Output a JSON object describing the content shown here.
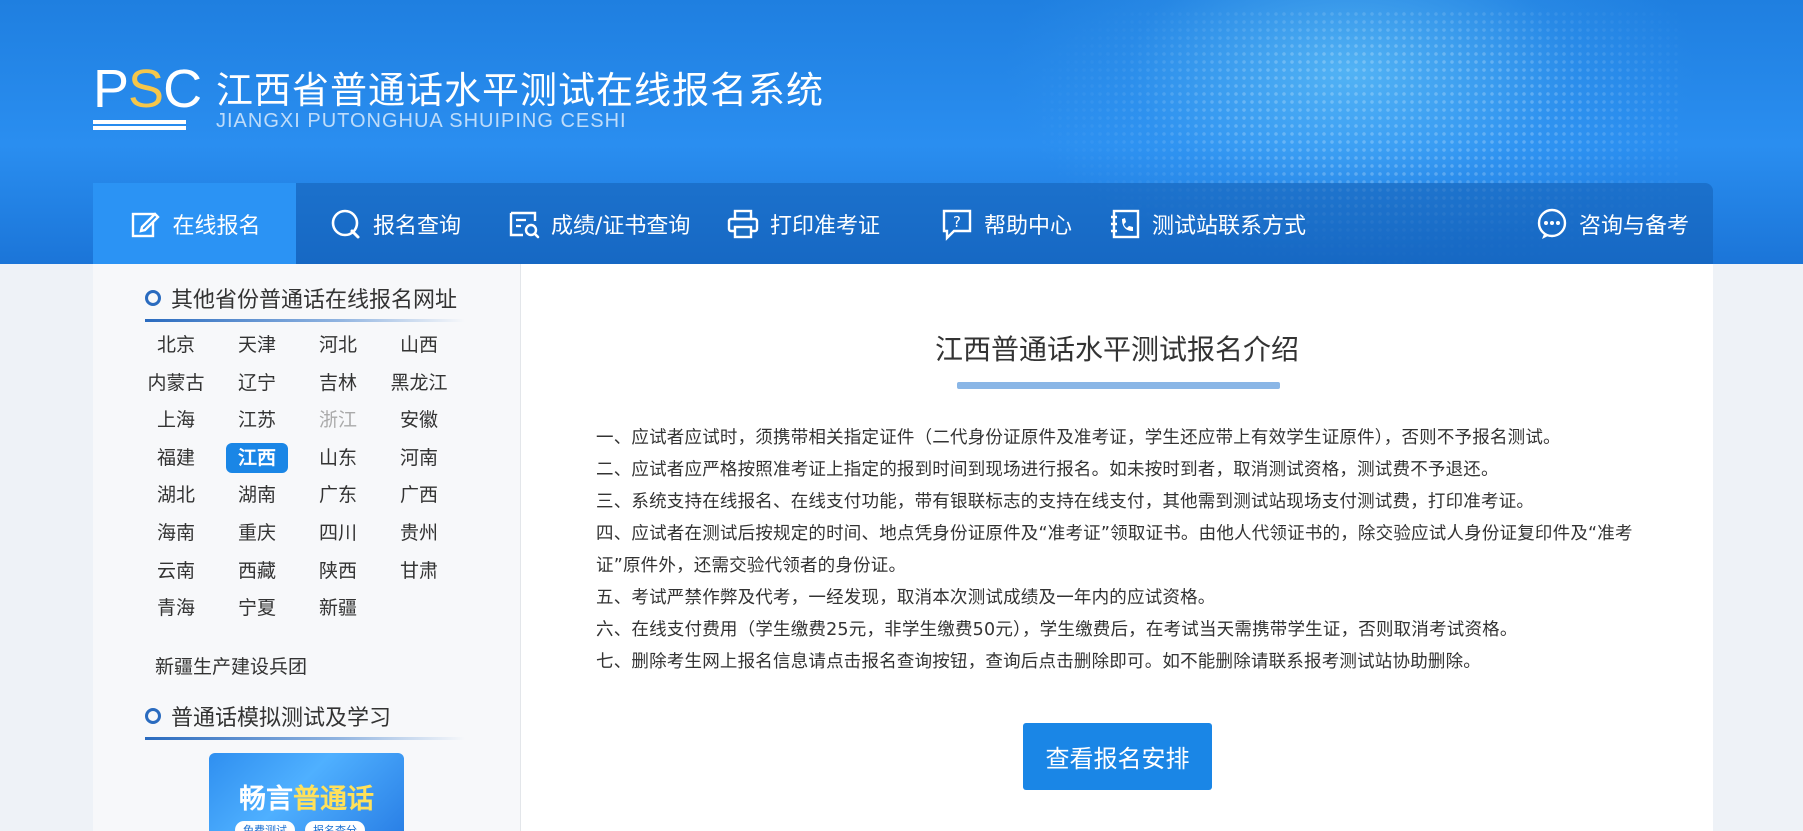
{
  "header": {
    "logo_text_p": "P",
    "logo_text_s": "S",
    "logo_text_c": "C",
    "title": "江西省普通话水平测试在线报名系统",
    "subtitle": "JIANGXI PUTONGHUA SHUIPING CESHI",
    "accent_color": "#f5c64a"
  },
  "nav": {
    "items": [
      {
        "label": "在线报名",
        "icon": "edit-icon"
      },
      {
        "label": "报名查询",
        "icon": "search-icon"
      },
      {
        "label": "成绩/证书查询",
        "icon": "certificate-search-icon"
      },
      {
        "label": "打印准考证",
        "icon": "printer-icon"
      },
      {
        "label": "帮助中心",
        "icon": "help-icon"
      },
      {
        "label": "测试站联系方式",
        "icon": "phone-book-icon"
      },
      {
        "label": "咨询与备考",
        "icon": "chat-icon"
      }
    ],
    "active_index": 0
  },
  "sidebar": {
    "heading_provinces": "其他省份普通话在线报名网址",
    "provinces": [
      "北京",
      "天津",
      "河北",
      "山西",
      "内蒙古",
      "辽宁",
      "吉林",
      "黑龙江",
      "上海",
      "江苏",
      "浙江",
      "安徽",
      "福建",
      "江西",
      "山东",
      "河南",
      "湖北",
      "湖南",
      "广东",
      "广西",
      "海南",
      "重庆",
      "四川",
      "贵州",
      "云南",
      "西藏",
      "陕西",
      "甘肃",
      "青海",
      "宁夏",
      "新疆"
    ],
    "active_province": "江西",
    "dim_province": "浙江",
    "bingtuan": "新疆生产建设兵团",
    "heading_practice": "普通话模拟测试及学习",
    "promo": {
      "title_a": "畅言",
      "title_b": "普通话",
      "chip1": "免费测试",
      "chip2": "报名查分"
    }
  },
  "main": {
    "title": "江西普通话水平测试报名介绍",
    "rules": [
      "一、应试者应试时，须携带相关指定证件（二代身份证原件及准考证，学生还应带上有效学生证原件），否则不予报名测试。",
      "二、应试者应严格按照准考证上指定的报到时间到现场进行报名。如未按时到者，取消测试资格，测试费不予退还。",
      "三、系统支持在线报名、在线支付功能，带有银联标志的支持在线支付，其他需到测试站现场支付测试费，打印准考证。",
      "四、应试者在测试后按规定的时间、地点凭身份证原件及“准考证”领取证书。由他人代领证书的，除交验应试人身份证复印件及“准考证”原件外，还需交验代领者的身份证。",
      "五、考试严禁作弊及代考，一经发现，取消本次测试成绩及一年内的应试资格。",
      "六、在线支付费用（学生缴费25元，非学生缴费50元），学生缴费后，在考试当天需携带学生证，否则取消考试资格。",
      "七、删除考生网上报名信息请点击报名查询按钮，查询后点击删除即可。如不能删除请联系报考测试站协助删除。"
    ],
    "cta_label": "查看报名安排"
  },
  "colors": {
    "primary": "#1a86e6",
    "header_blue": "#2a8ef0",
    "nav_active": "#2b93f4"
  }
}
